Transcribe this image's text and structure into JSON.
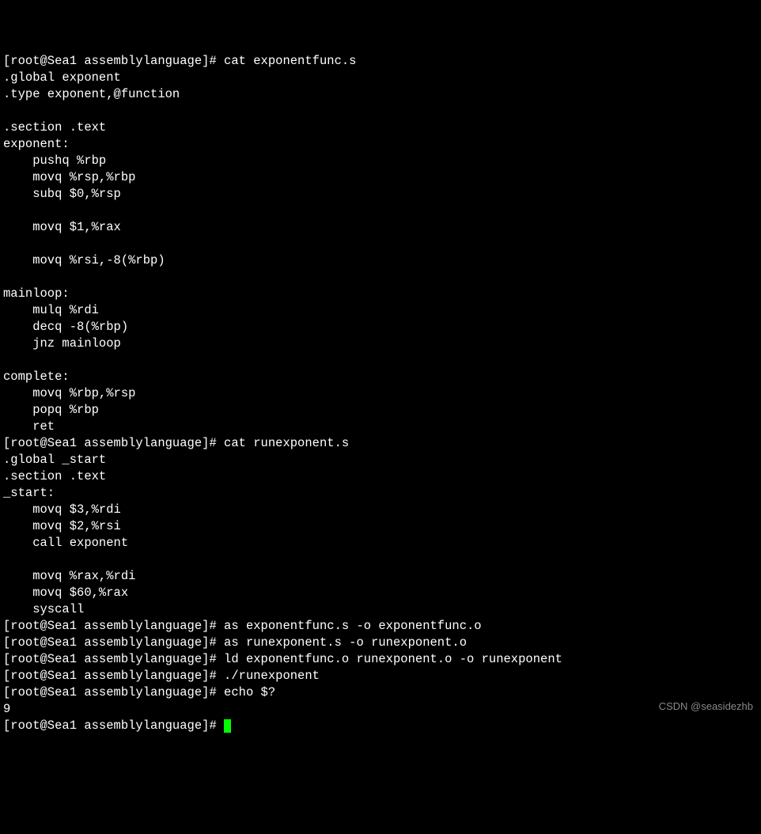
{
  "prompt": "[root@Sea1 assemblylanguage]# ",
  "cmd1": "cat exponentfunc.s",
  "file1": ".global exponent\n.type exponent,@function\n\n.section .text\nexponent:\n    pushq %rbp\n    movq %rsp,%rbp\n    subq $0,%rsp\n\n    movq $1,%rax\n\n    movq %rsi,-8(%rbp)\n\nmainloop:\n    mulq %rdi\n    decq -8(%rbp)\n    jnz mainloop\n\ncomplete:\n    movq %rbp,%rsp\n    popq %rbp\n    ret",
  "cmd2": "cat runexponent.s",
  "file2": ".global _start\n.section .text\n_start:\n    movq $3,%rdi\n    movq $2,%rsi\n    call exponent\n\n    movq %rax,%rdi\n    movq $60,%rax\n    syscall",
  "cmd3": "as exponentfunc.s -o exponentfunc.o",
  "cmd4": "as runexponent.s -o runexponent.o",
  "cmd5": "ld exponentfunc.o runexponent.o -o runexponent",
  "cmd6": "./runexponent",
  "cmd7": "echo $?",
  "out7": "9",
  "watermark": "CSDN @seasidezhb"
}
